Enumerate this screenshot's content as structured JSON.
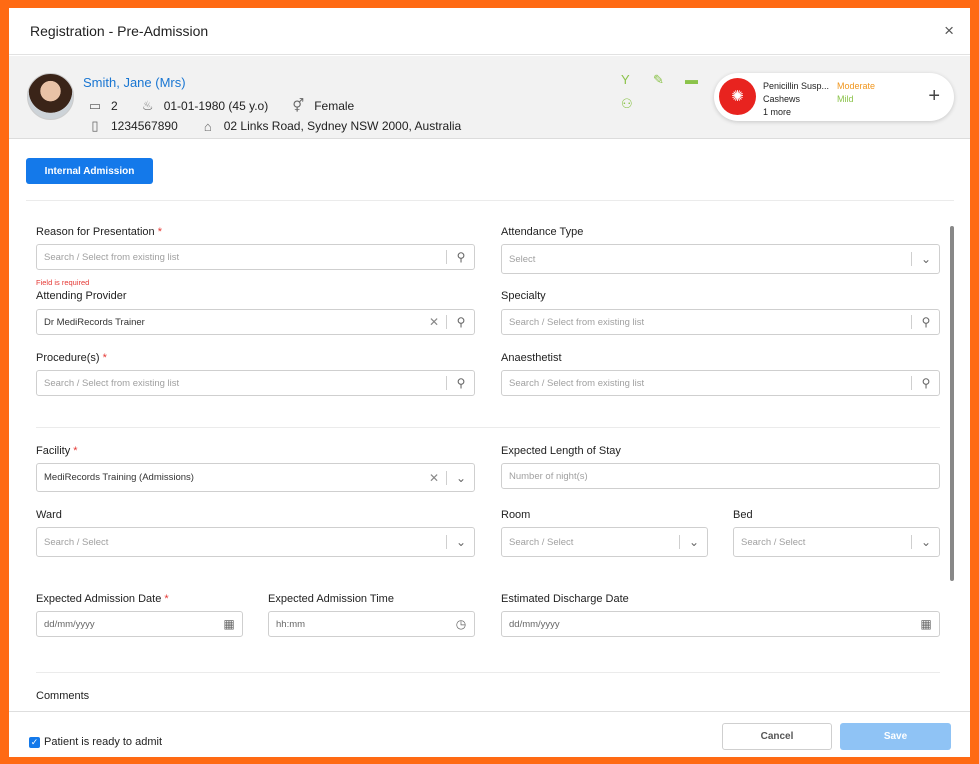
{
  "modal": {
    "title": "Registration - Pre-Admission",
    "close": "×"
  },
  "patient": {
    "name": "Smith, Jane (Mrs)",
    "id_count": "2",
    "dob": "01-01-1980 (45 y.o)",
    "gender": "Female",
    "phone": "1234567890",
    "address": "02 Links Road, Sydney NSW 2000, Australia"
  },
  "allergies": {
    "items": [
      {
        "name": "Penicillin Susp...",
        "severity": "Moderate"
      },
      {
        "name": "Cashews",
        "severity": "Mild"
      }
    ],
    "more": "1 more",
    "colors": {
      "moderate": "#f0961e",
      "mild": "#8bc34a",
      "badge": "#e8231f"
    }
  },
  "buttons": {
    "internal_admission": "Internal Admission",
    "cancel": "Cancel",
    "save": "Save"
  },
  "form": {
    "reason": {
      "label": "Reason for Presentation",
      "placeholder": "Search / Select from existing list",
      "error": "Field is required"
    },
    "attendance": {
      "label": "Attendance Type",
      "placeholder": "Select"
    },
    "provider": {
      "label": "Attending Provider",
      "value": "Dr MediRecords Trainer"
    },
    "specialty": {
      "label": "Specialty",
      "placeholder": "Search / Select from existing list"
    },
    "procedures": {
      "label": "Procedure(s)",
      "placeholder": "Search / Select from existing list"
    },
    "anaesthetist": {
      "label": "Anaesthetist",
      "placeholder": "Search / Select from existing list"
    },
    "facility": {
      "label": "Facility",
      "value": "MediRecords Training (Admissions)"
    },
    "length_of_stay": {
      "label": "Expected Length of Stay",
      "placeholder": "Number of night(s)"
    },
    "ward": {
      "label": "Ward",
      "placeholder": "Search / Select"
    },
    "room": {
      "label": "Room",
      "placeholder": "Search / Select"
    },
    "bed": {
      "label": "Bed",
      "placeholder": "Search / Select"
    },
    "admission_date": {
      "label": "Expected Admission Date",
      "placeholder": "dd/mm/yyyy"
    },
    "admission_time": {
      "label": "Expected Admission Time",
      "placeholder": "hh:mm"
    },
    "discharge_date": {
      "label": "Estimated Discharge Date",
      "placeholder": "dd/mm/yyyy"
    },
    "comments": {
      "label": "Comments"
    },
    "required_mark": "*"
  },
  "footer": {
    "ready_label": "Patient is ready to admit",
    "ready_checked": true
  },
  "colors": {
    "accent": "#1479ea",
    "link": "#1976d2",
    "error": "#e53935",
    "frame": "#ff6a13"
  }
}
